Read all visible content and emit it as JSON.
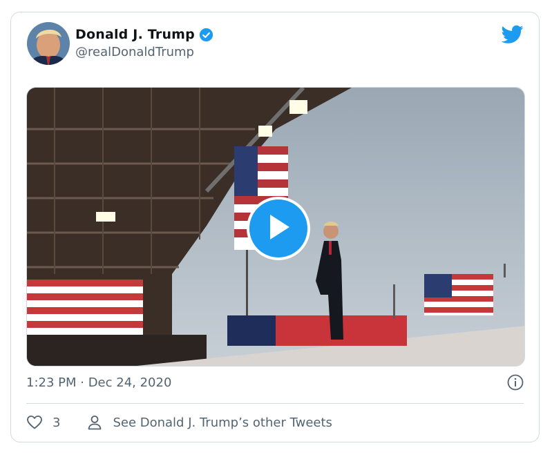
{
  "tweet": {
    "author_name": "Donald J. Trump",
    "author_handle": "@realDonaldTrump",
    "timestamp": "1:23 PM · Dec 24, 2020",
    "like_count": "3",
    "other_tweets_label": "See Donald J. Trump’s other Tweets"
  },
  "icons": {
    "verified": "verified-badge-icon",
    "brand": "twitter-bird-icon",
    "play": "play-icon",
    "info": "info-icon",
    "like": "heart-icon",
    "profile": "person-icon"
  },
  "colors": {
    "accent": "#1d9bf0",
    "secondary_text": "#536471",
    "border": "#cfd9de"
  }
}
